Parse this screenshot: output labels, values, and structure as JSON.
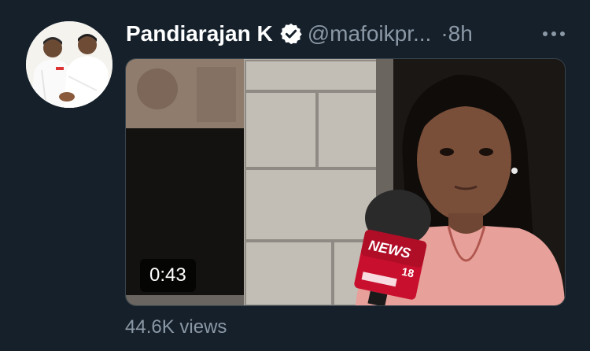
{
  "tweet": {
    "author": {
      "display_name": "Pandiarajan K",
      "handle": "@mafoikpr...",
      "verified": true,
      "avatar_icon": "profile-photo-two-men-handshake"
    },
    "separator": "·",
    "time": "8h",
    "more_icon": "more-horizontal-icon",
    "media": {
      "type": "video",
      "duration": "0:43",
      "mic_badge_text": "NEWS",
      "mic_badge_number": "18"
    },
    "views": "44.6K views"
  },
  "colors": {
    "background": "#15202b",
    "secondary_text": "#8b98a5",
    "primary_text": "#ffffff",
    "news_red": "#c8102e"
  }
}
